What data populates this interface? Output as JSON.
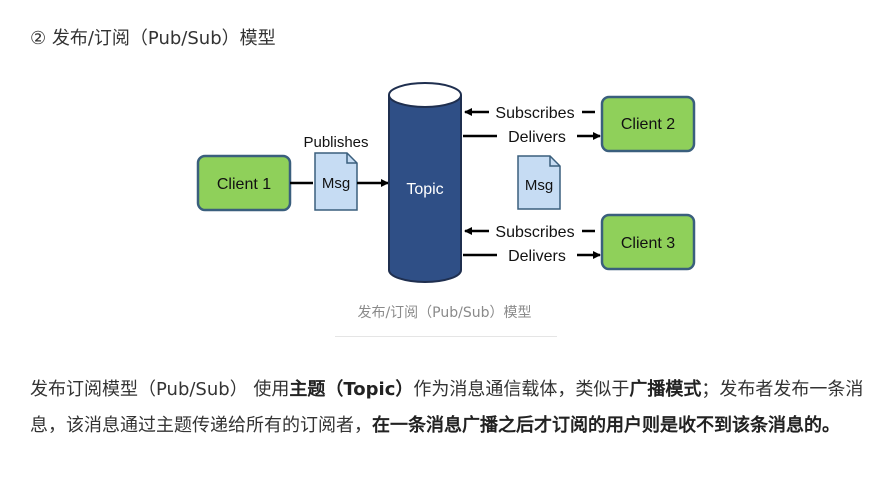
{
  "heading": "② 发布/订阅（Pub/Sub）模型",
  "diagram": {
    "client1": "Client 1",
    "client2": "Client 2",
    "client3": "Client 3",
    "topic": "Topic",
    "publishes": "Publishes",
    "msg_pub": "Msg",
    "msg_center": "Msg",
    "subscribes_top": "Subscribes",
    "delivers_top": "Delivers",
    "subscribes_bottom": "Subscribes",
    "delivers_bottom": "Delivers"
  },
  "caption": "发布/订阅（Pub/Sub）模型",
  "paragraph": {
    "p1": "发布订阅模型（Pub/Sub） 使用",
    "b1": "主题（Topic）",
    "p2": "作为消息通信载体，类似于",
    "b2": "广播模式",
    "p3": "；发布者发布一条消息，该消息通过主题传递给所有的订阅者，",
    "b3": "在一条消息广播之后才订阅的用户则是收不到该条消息的。"
  },
  "colors": {
    "client_fill": "#8fd05a",
    "client_stroke": "#3a5f7d",
    "topic_fill": "#2f4f86",
    "topic_top": "#ffffff",
    "msg_fill": "#c6dcf3",
    "msg_stroke": "#3a5f7d"
  }
}
